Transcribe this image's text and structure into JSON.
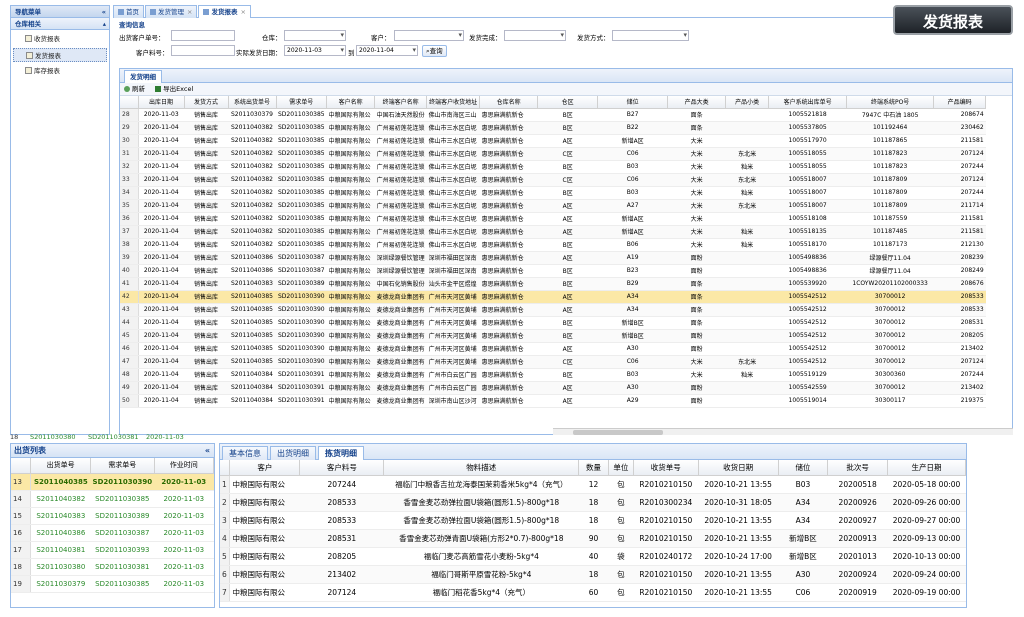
{
  "sidebar": {
    "title": "导航菜单",
    "group": "仓库相关",
    "items": [
      "收货报表",
      "发货报表",
      "库存报表"
    ],
    "collapse": "«"
  },
  "tabs": [
    {
      "label": "首页",
      "close": ""
    },
    {
      "label": "发货管理",
      "close": "×"
    },
    {
      "label": "发货报表",
      "close": "×"
    }
  ],
  "page_title": "发货报表",
  "query": {
    "title": "查询信息",
    "labels": {
      "customer_order": "出货客户单号：",
      "warehouse": "仓库：",
      "customer": "客户：",
      "status": "发货完成：",
      "method": "发货方式：",
      "material": "客户料号：",
      "date_range": "实际发货日期：",
      "to": "到"
    },
    "date_from": "2020-11-03",
    "date_to": "2020-11-04",
    "search_btn": "查询"
  },
  "main_grid": {
    "tab": "发货明细",
    "toolbar": {
      "refresh": "刷新",
      "export": "导出Excel"
    },
    "columns": [
      "",
      "出库日期",
      "发货方式",
      "系统出货单号",
      "需求单号",
      "客户名称",
      "终端客户名称",
      "终端客户收货地址",
      "仓库名称",
      "仓区",
      "储位",
      "产品大类",
      "产品小类",
      "客户系统出库单号",
      "终端系统PO号",
      "产品编码"
    ],
    "rows": [
      [
        "28",
        "2020-11-03",
        "销售出库",
        "S2011030379",
        "SD2011030385",
        "中粮国际有限公",
        "中国石油天然股份",
        "佛山市南海区三山",
        "惠思麻满航新仓",
        "B区",
        "B27",
        "面条",
        "",
        "1005521818",
        "7947C 中石油 1805",
        "208674"
      ],
      [
        "29",
        "2020-11-04",
        "销售出库",
        "S2011040382",
        "SD2011030385",
        "中粮国际有限公",
        "广州易初莲花连锁",
        "佛山市三水区白坭",
        "惠思麻满航新仓",
        "B区",
        "B22",
        "面条",
        "",
        "1005537805",
        "101192464",
        "230462"
      ],
      [
        "30",
        "2020-11-04",
        "销售出库",
        "S2011040382",
        "SD2011030385",
        "中粮国际有限公",
        "广州易初莲花连锁",
        "佛山市三水区白坭",
        "惠思麻满航新仓",
        "A区",
        "新增A区",
        "大米",
        "",
        "1005517970",
        "101187865",
        "211581"
      ],
      [
        "31",
        "2020-11-04",
        "销售出库",
        "S2011040382",
        "SD2011030385",
        "中粮国际有限公",
        "广州易初莲花连锁",
        "佛山市三水区白坭",
        "惠思麻满航新仓",
        "C区",
        "C06",
        "大米",
        "东北米",
        "1005518055",
        "101187823",
        "207124"
      ],
      [
        "32",
        "2020-11-04",
        "销售出库",
        "S2011040382",
        "SD2011030385",
        "中粮国际有限公",
        "广州易初莲花连锁",
        "佛山市三水区白坭",
        "惠思麻满航新仓",
        "B区",
        "B03",
        "大米",
        "籼米",
        "1005518055",
        "101187823",
        "207244"
      ],
      [
        "33",
        "2020-11-04",
        "销售出库",
        "S2011040382",
        "SD2011030385",
        "中粮国际有限公",
        "广州易初莲花连锁",
        "佛山市三水区白坭",
        "惠思麻满航新仓",
        "C区",
        "C06",
        "大米",
        "东北米",
        "1005518007",
        "101187809",
        "207124"
      ],
      [
        "34",
        "2020-11-04",
        "销售出库",
        "S2011040382",
        "SD2011030385",
        "中粮国际有限公",
        "广州易初莲花连锁",
        "佛山市三水区白坭",
        "惠思麻满航新仓",
        "B区",
        "B03",
        "大米",
        "籼米",
        "1005518007",
        "101187809",
        "207244"
      ],
      [
        "35",
        "2020-11-04",
        "销售出库",
        "S2011040382",
        "SD2011030385",
        "中粮国际有限公",
        "广州易初莲花连锁",
        "佛山市三水区白坭",
        "惠思麻满航新仓",
        "A区",
        "A27",
        "大米",
        "东北米",
        "1005518007",
        "101187809",
        "211714"
      ],
      [
        "36",
        "2020-11-04",
        "销售出库",
        "S2011040382",
        "SD2011030385",
        "中粮国际有限公",
        "广州易初莲花连锁",
        "佛山市三水区白坭",
        "惠思麻满航新仓",
        "A区",
        "新增A区",
        "大米",
        "",
        "1005518108",
        "101187559",
        "211581"
      ],
      [
        "37",
        "2020-11-04",
        "销售出库",
        "S2011040382",
        "SD2011030385",
        "中粮国际有限公",
        "广州易初莲花连锁",
        "佛山市三水区白坭",
        "惠思麻满航新仓",
        "A区",
        "新增A区",
        "大米",
        "籼米",
        "1005518135",
        "101187485",
        "211581"
      ],
      [
        "38",
        "2020-11-04",
        "销售出库",
        "S2011040382",
        "SD2011030385",
        "中粮国际有限公",
        "广州易初莲花连锁",
        "佛山市三水区白坭",
        "惠思麻满航新仓",
        "B区",
        "B06",
        "大米",
        "籼米",
        "1005518170",
        "101187173",
        "212130"
      ],
      [
        "39",
        "2020-11-04",
        "销售出库",
        "S2011040386",
        "SD2011030387",
        "中粮国际有限公",
        "深圳绿源餐饮管理",
        "深圳市福田区深南",
        "惠思麻满航新仓",
        "A区",
        "A19",
        "面粉",
        "",
        "1005498836",
        "绿源餐厅11.04",
        "208239"
      ],
      [
        "40",
        "2020-11-04",
        "销售出库",
        "S2011040386",
        "SD2011030387",
        "中粮国际有限公",
        "深圳绿源餐饮管理",
        "深圳市福田区深南",
        "惠思麻满航新仓",
        "B区",
        "B23",
        "面粉",
        "",
        "1005498836",
        "绿源餐厅11.04",
        "208249"
      ],
      [
        "41",
        "2020-11-04",
        "销售出库",
        "S2011040383",
        "SD2011030389",
        "中粮国际有限公",
        "中国石化销售股份",
        "汕头市金平区煜煌",
        "惠思麻满航新仓",
        "B区",
        "B29",
        "面条",
        "",
        "1005539920",
        "1COYW20201102000333",
        "208676"
      ],
      [
        "42",
        "2020-11-04",
        "销售出库",
        "S2011040385",
        "SD2011030390",
        "中粮国际有限公",
        "麦德龙商业集团有",
        "广州市天河区黄埔",
        "惠思麻满航新仓",
        "A区",
        "A34",
        "面条",
        "",
        "1005542512",
        "30700012",
        "208533"
      ],
      [
        "43",
        "2020-11-04",
        "销售出库",
        "S2011040385",
        "SD2011030390",
        "中粮国际有限公",
        "麦德龙商业集团有",
        "广州市天河区黄埔",
        "惠思麻满航新仓",
        "A区",
        "A34",
        "面条",
        "",
        "1005542512",
        "30700012",
        "208533"
      ],
      [
        "44",
        "2020-11-04",
        "销售出库",
        "S2011040385",
        "SD2011030390",
        "中粮国际有限公",
        "麦德龙商业集团有",
        "广州市天河区黄埔",
        "惠思麻满航新仓",
        "B区",
        "新增B区",
        "面条",
        "",
        "1005542512",
        "30700012",
        "208531"
      ],
      [
        "45",
        "2020-11-04",
        "销售出库",
        "S2011040385",
        "SD2011030390",
        "中粮国际有限公",
        "麦德龙商业集团有",
        "广州市天河区黄埔",
        "惠思麻满航新仓",
        "B区",
        "新增B区",
        "面粉",
        "",
        "1005542512",
        "30700012",
        "208205"
      ],
      [
        "46",
        "2020-11-04",
        "销售出库",
        "S2011040385",
        "SD2011030390",
        "中粮国际有限公",
        "麦德龙商业集团有",
        "广州市天河区黄埔",
        "惠思麻满航新仓",
        "A区",
        "A30",
        "面粉",
        "",
        "1005542512",
        "30700012",
        "213402"
      ],
      [
        "47",
        "2020-11-04",
        "销售出库",
        "S2011040385",
        "SD2011030390",
        "中粮国际有限公",
        "麦德龙商业集团有",
        "广州市天河区黄埔",
        "惠思麻满航新仓",
        "C区",
        "C06",
        "大米",
        "东北米",
        "1005542512",
        "30700012",
        "207124"
      ],
      [
        "48",
        "2020-11-04",
        "销售出库",
        "S2011040384",
        "SD2011030391",
        "中粮国际有限公",
        "麦德龙商业集团有",
        "广州市白云区广园",
        "惠思麻满航新仓",
        "B区",
        "B03",
        "大米",
        "籼米",
        "1005519129",
        "30300360",
        "207244"
      ],
      [
        "49",
        "2020-11-04",
        "销售出库",
        "S2011040384",
        "SD2011030391",
        "中粮国际有限公",
        "麦德龙商业集团有",
        "广州市白云区广园",
        "惠思麻满航新仓",
        "A区",
        "A30",
        "面粉",
        "",
        "1005542559",
        "30700012",
        "213402"
      ],
      [
        "50",
        "2020-11-04",
        "销售出库",
        "S2011040384",
        "SD2011030391",
        "中粮国际有限公",
        "麦德龙商业集团有",
        "深圳市南山区沙河",
        "惠思麻满航新仓",
        "A区",
        "A29",
        "面粉",
        "",
        "1005519014",
        "30300117",
        "219375"
      ]
    ]
  },
  "top_strip": [
    "18",
    "S2011030380",
    "SD2011030381",
    "2020-11-03"
  ],
  "left_panel": {
    "title": "出货列表",
    "columns": [
      "",
      "出货单号",
      "需求单号",
      "作业时间"
    ],
    "rows": [
      [
        "13",
        "S2011040385",
        "SD2011030390",
        "2020-11-03"
      ],
      [
        "14",
        "S2011040382",
        "SD2011030385",
        "2020-11-03"
      ],
      [
        "15",
        "S2011040383",
        "SD2011030389",
        "2020-11-03"
      ],
      [
        "16",
        "S2011040386",
        "SD2011030387",
        "2020-11-03"
      ],
      [
        "17",
        "S2011040381",
        "SD2011030393",
        "2020-11-03"
      ],
      [
        "18",
        "S2011030380",
        "SD2011030381",
        "2020-11-03"
      ],
      [
        "19",
        "S2011030379",
        "SD2011030385",
        "2020-11-03"
      ]
    ]
  },
  "right_panel": {
    "tabs": [
      "基本信息",
      "出货明细",
      "拣货明细"
    ],
    "columns": [
      "",
      "客户",
      "客户料号",
      "物料描述",
      "数量",
      "单位",
      "收货单号",
      "收货日期",
      "储位",
      "批次号",
      "生产日期"
    ],
    "rows": [
      [
        "1",
        "中粮国际有限公",
        "207244",
        "福临门中粮香吉拉龙海泰国茉莉香米5kg*4（充气）",
        "12",
        "包",
        "R2010210150",
        "2020-10-21 13:55",
        "B03",
        "20200518",
        "2020-05-18 00:00"
      ],
      [
        "2",
        "中粮国际有限公",
        "208533",
        "香雪金麦芯劲弹拉面U袋箱(圆形1.5)-800g*18",
        "18",
        "包",
        "R2010300234",
        "2020-10-31 18:05",
        "A34",
        "20200926",
        "2020-09-26 00:00"
      ],
      [
        "3",
        "中粮国际有限公",
        "208533",
        "香雪金麦芯劲弹拉面U袋箱(圆形1.5)-800g*18",
        "18",
        "包",
        "R2010210150",
        "2020-10-21 13:55",
        "A34",
        "20200927",
        "2020-09-27 00:00"
      ],
      [
        "4",
        "中粮国际有限公",
        "208531",
        "香雪金麦芯劲弹青面U袋箱(方形2*0.7)-800g*18",
        "90",
        "包",
        "R2010210150",
        "2020-10-21 13:55",
        "新增B区",
        "20200913",
        "2020-09-13 00:00"
      ],
      [
        "5",
        "中粮国际有限公",
        "208205",
        "福临门麦芯高筋雪花小麦粉-5kg*4",
        "40",
        "袋",
        "R2010240172",
        "2020-10-24 17:00",
        "新增B区",
        "20201013",
        "2020-10-13 00:00"
      ],
      [
        "6",
        "中粮国际有限公",
        "213402",
        "福临门哥斯平原雪花粉-5kg*4",
        "18",
        "包",
        "R2010210150",
        "2020-10-21 13:55",
        "A30",
        "20200924",
        "2020-09-24 00:00"
      ],
      [
        "7",
        "中粮国际有限公",
        "207124",
        "福临门稻花香5kg*4（充气）",
        "60",
        "包",
        "R2010210150",
        "2020-10-21 13:55",
        "C06",
        "20200919",
        "2020-09-19 00:00"
      ]
    ]
  }
}
